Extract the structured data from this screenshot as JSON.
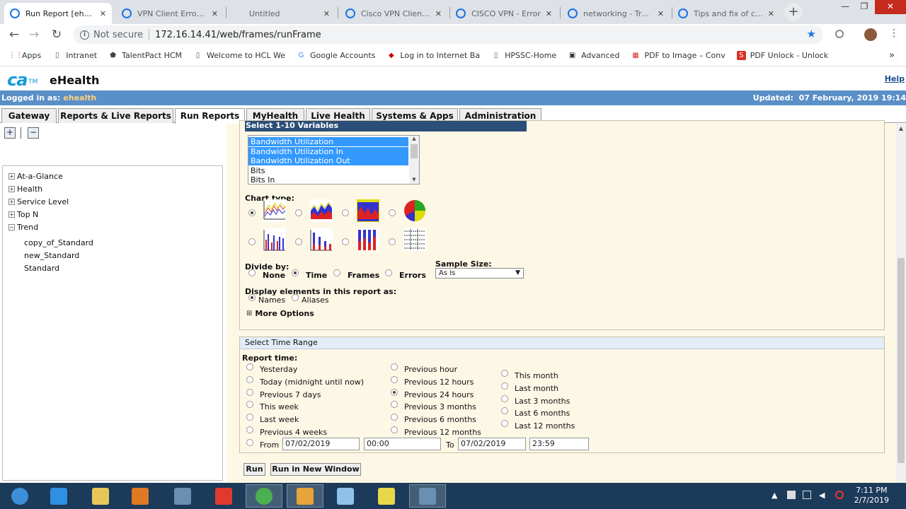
{
  "browser": {
    "tabs": [
      {
        "title": "Run Report [ehealth]",
        "icon_color": "#1a73e8",
        "active": true
      },
      {
        "title": "VPN Client Error : T",
        "icon_color": "#1a73e8",
        "active": false
      },
      {
        "title": "Untitled",
        "icon_color": "",
        "active": false
      },
      {
        "title": "Cisco VPN Client: R",
        "icon_color": "#1a73e8",
        "active": false
      },
      {
        "title": "CISCO VPN - Error",
        "icon_color": "#1a73e8",
        "active": false
      },
      {
        "title": "networking - Troub",
        "icon_color": "#1a73e8",
        "active": false
      },
      {
        "title": "Tips and fix of com",
        "icon_color": "#1a73e8",
        "active": false
      }
    ],
    "new_tab": "+",
    "window_controls": {
      "minimize": "—",
      "maximize": "❐",
      "close": "✕"
    },
    "nav": {
      "back": "←",
      "forward": "→",
      "reload": "↻"
    },
    "not_secure": "Not secure",
    "url": "172.16.14.41/web/frames/runFrame",
    "bookmarks": [
      {
        "label": "Apps",
        "icon": "apps-grid-icon"
      },
      {
        "label": "Intranet",
        "icon": "page-icon"
      },
      {
        "label": "TalentPact HCM",
        "icon": "gem-icon"
      },
      {
        "label": "Welcome to HCL We",
        "icon": "page-icon"
      },
      {
        "label": "Google Accounts",
        "icon": "google-icon"
      },
      {
        "label": "Log in to Internet Ba",
        "icon": "bank-icon"
      },
      {
        "label": "HPSSC-Home",
        "icon": "page-icon"
      },
      {
        "label": "Advanced",
        "icon": "briefcase-icon"
      },
      {
        "label": "PDF to Image – Conv",
        "icon": "pdf-icon"
      },
      {
        "label": "PDF Unlock - Unlock",
        "icon": "pdf-s-icon"
      }
    ],
    "bookmarks_more": "»"
  },
  "app": {
    "logo": "ca",
    "logo_tm": "TM",
    "title": "eHealth",
    "help": "Help",
    "logged_in_label": "Logged in as:",
    "logged_in_user": "ehealth",
    "updated_label": "Updated:",
    "updated_value": "07 February, 2019 19:14",
    "tabs": [
      "Gateway",
      "Reports & Live Reports",
      "Run Reports",
      "MyHealth",
      "Live Health",
      "Systems & Apps",
      "Administration"
    ],
    "selected_tab": "Run Reports"
  },
  "tree": {
    "nodes": [
      {
        "label": "At-a-Glance",
        "expanded": false
      },
      {
        "label": "Health",
        "expanded": false
      },
      {
        "label": "Service Level",
        "expanded": false
      },
      {
        "label": "Top N",
        "expanded": false
      },
      {
        "label": "Trend",
        "expanded": true
      }
    ],
    "trend_children": [
      "copy_of_Standard",
      "new_Standard",
      "Standard"
    ]
  },
  "form": {
    "variables_header": "Select 1-10 Variables",
    "variables": [
      {
        "label": "Bandwidth Utilization",
        "selected": true
      },
      {
        "label": "Bandwidth Utilization In",
        "selected": true
      },
      {
        "label": "Bandwidth Utilization Out",
        "selected": true
      },
      {
        "label": "Bits",
        "selected": false
      },
      {
        "label": "Bits In",
        "selected": false
      }
    ],
    "chart_type_label": "Chart type:",
    "chart_types": [
      "line-chart-icon",
      "area-chart-icon",
      "stacked-area-chart-icon",
      "pie-chart-icon",
      "bar-chart-icon",
      "stacked-bar-chart-icon",
      "column-chart-icon",
      "table-chart-icon"
    ],
    "chart_type_selected": 0,
    "divide_by_label": "Divide by:",
    "divide_by_options": [
      "None",
      "Time",
      "Frames",
      "Errors"
    ],
    "divide_by_selected": "Time",
    "sample_size_label": "Sample Size:",
    "sample_size_value": "As Is",
    "display_label": "Display elements in this report as:",
    "display_options": [
      "Names",
      "Aliases"
    ],
    "display_selected": "Names",
    "more_options": "More Options",
    "more_options_icon": "⊞"
  },
  "time_range": {
    "header": "Select Time Range",
    "report_time_label": "Report time:",
    "col1": [
      "Yesterday",
      "Today (midnight until now)",
      "Previous 7 days",
      "This week",
      "Last week",
      "Previous 4 weeks"
    ],
    "col2": [
      "Previous hour",
      "Previous 12 hours",
      "Previous 24 hours",
      "Previous 3 months",
      "Previous 6 months",
      "Previous 12 months"
    ],
    "col3": [
      "This month",
      "Last month",
      "Last 3 months",
      "Last 6 months",
      "Last 12 months"
    ],
    "selected": "Previous 24 hours",
    "from_label": "From",
    "from_date": "07/02/2019",
    "from_time": "00:00",
    "to_label": "To",
    "to_date": "07/02/2019",
    "to_time": "23:59"
  },
  "buttons": {
    "run": "Run",
    "run_new_window": "Run in New Window"
  },
  "taskbar": {
    "apps": [
      "windows-start-icon",
      "internet-explorer-icon",
      "file-explorer-icon",
      "media-player-icon",
      "network-app-icon",
      "remote-app-icon",
      "chrome-icon",
      "outlook-icon",
      "notepad-icon",
      "lock-app-icon",
      "vpn-app-icon"
    ],
    "tray": "▲",
    "time": "7:11 PM",
    "date": "2/7/2019"
  }
}
